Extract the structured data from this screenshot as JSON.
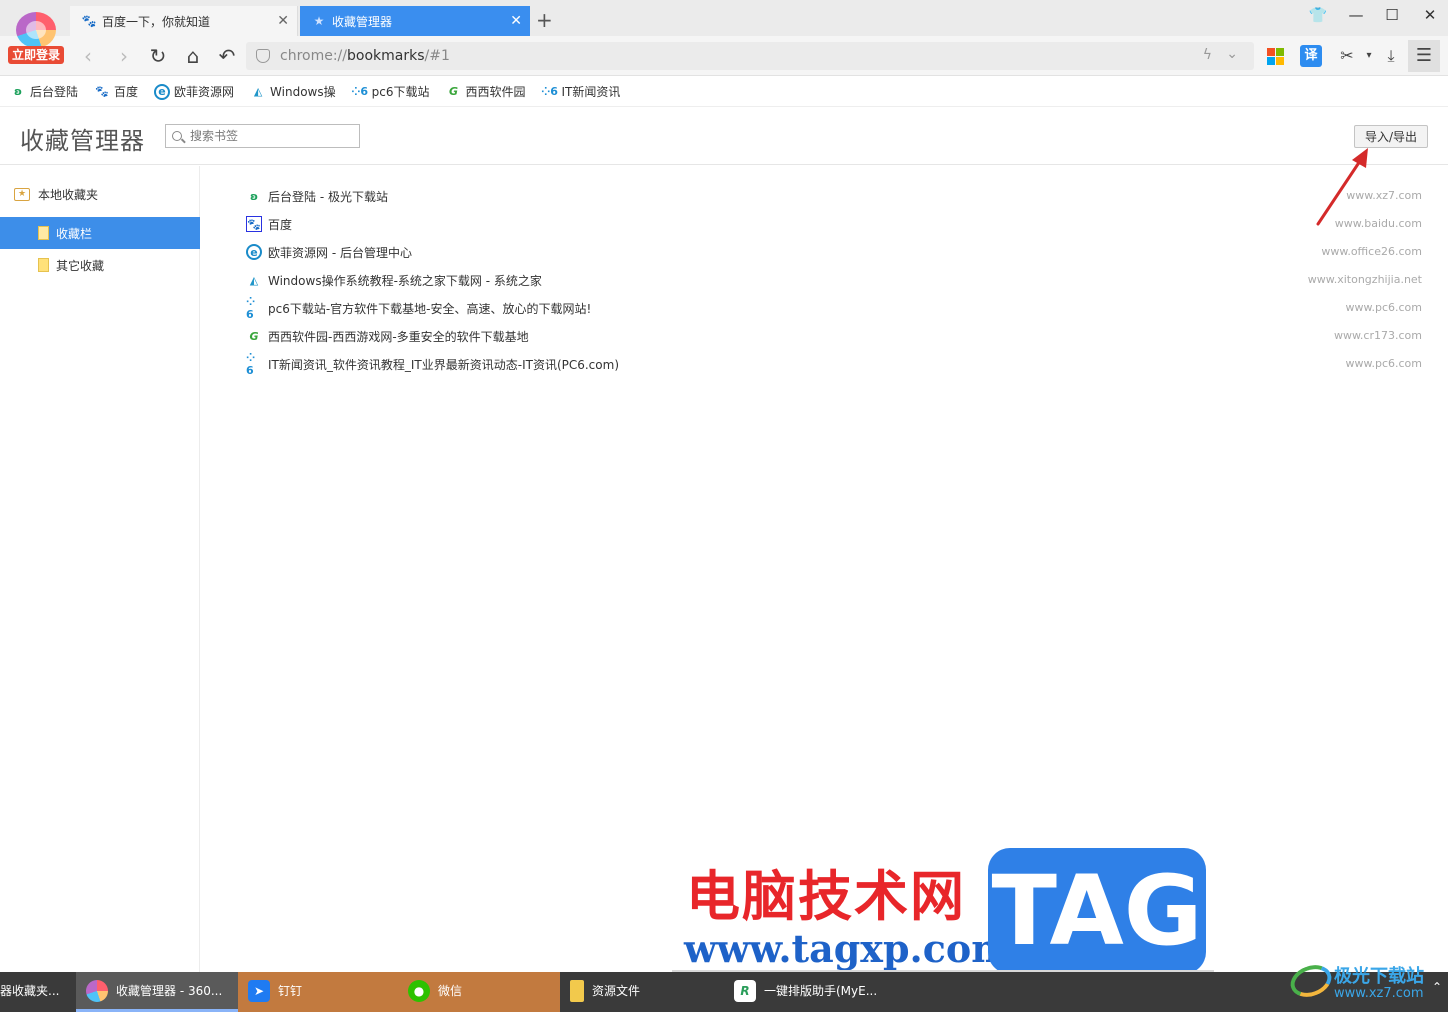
{
  "login_label": "立即登录",
  "tabs": [
    {
      "title": "百度一下，你就知道",
      "icon": "baidu-paw-icon"
    },
    {
      "title": "收藏管理器",
      "icon": "star-icon"
    }
  ],
  "address": {
    "scheme": "chrome://",
    "host": "bookmarks",
    "rest": "/#1"
  },
  "toolbar": {
    "translate_label": "译"
  },
  "bookmark_bar": [
    {
      "label": "后台登陆",
      "icon": "xz7-icon"
    },
    {
      "label": "百度",
      "icon": "baidu-paw-icon"
    },
    {
      "label": "欧菲资源网",
      "icon": "office26-icon"
    },
    {
      "label": "Windows操",
      "icon": "xitongzhijia-icon"
    },
    {
      "label": "pc6下载站",
      "icon": "pc6-icon"
    },
    {
      "label": "西西软件园",
      "icon": "cr173-icon"
    },
    {
      "label": "IT新闻资讯",
      "icon": "pc6-icon"
    }
  ],
  "page": {
    "title": "收藏管理器",
    "search_placeholder": "搜索书签",
    "import_export_label": "导入/导出"
  },
  "sidebar": {
    "root": "本地收藏夹",
    "items": [
      {
        "label": "收藏栏",
        "selected": true
      },
      {
        "label": "其它收藏",
        "selected": false
      }
    ]
  },
  "bookmarks": [
    {
      "title": "后台登陆 - 极光下载站",
      "url": "www.xz7.com",
      "icon": "xz7-icon"
    },
    {
      "title": "百度",
      "url": "www.baidu.com",
      "icon": "baidu-paw-icon"
    },
    {
      "title": "欧菲资源网 - 后台管理中心",
      "url": "www.office26.com",
      "icon": "office26-icon"
    },
    {
      "title": "Windows操作系统教程-系统之家下载网 - 系统之家",
      "url": "www.xitongzhijia.net",
      "icon": "xitongzhijia-icon"
    },
    {
      "title": "pc6下载站-官方软件下载基地-安全、高速、放心的下载网站!",
      "url": "www.pc6.com",
      "icon": "pc6-icon"
    },
    {
      "title": "西西软件园-西西游戏网-多重安全的软件下载基地",
      "url": "www.cr173.com",
      "icon": "cr173-icon"
    },
    {
      "title": "IT新闻资讯_软件资讯教程_IT业界最新资讯动态-IT资讯(PC6.com)",
      "url": "www.pc6.com",
      "icon": "pc6-icon"
    }
  ],
  "watermark": {
    "cn": "电脑技术网",
    "url": "www.tagxp.com",
    "tag": "TAG"
  },
  "taskbar": [
    {
      "label": "器收藏夹...",
      "style": "dark"
    },
    {
      "label": "收藏管理器 - 360...",
      "style": "active"
    },
    {
      "label": "钉钉",
      "style": "orange"
    },
    {
      "label": "微信",
      "style": "orange"
    },
    {
      "label": "资源文件",
      "style": "dark"
    },
    {
      "label": "一键排版助手(MyE...",
      "style": "dark"
    }
  ],
  "corner_logo": {
    "name": "极光下载站",
    "url": "www.xz7.com"
  },
  "colors": {
    "accent": "#3a8eef",
    "selected": "#3d8ee9",
    "arrow": "#d42a2a"
  }
}
